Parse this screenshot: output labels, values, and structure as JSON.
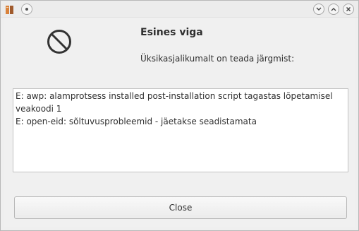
{
  "window": {
    "title": "",
    "controls": [
      "minimize-icon",
      "maximize-icon",
      "close-icon"
    ]
  },
  "dialog": {
    "icon": "stop-icon",
    "title": "Esines viga",
    "subtitle": "Üksikasjalikumalt on teada järgmist:",
    "details": "E: awp: alamprotsess installed post-installation script tagastas lõpetamisel veakoodi 1\nE: open-eid: sõltuvusprobleemid - jäetakse seadistamata",
    "close_label": "Close"
  },
  "colors": {
    "background": "#efefef",
    "text": "#2f2f2f",
    "textarea_bg": "#ffffff",
    "border": "#c2c2c2"
  }
}
